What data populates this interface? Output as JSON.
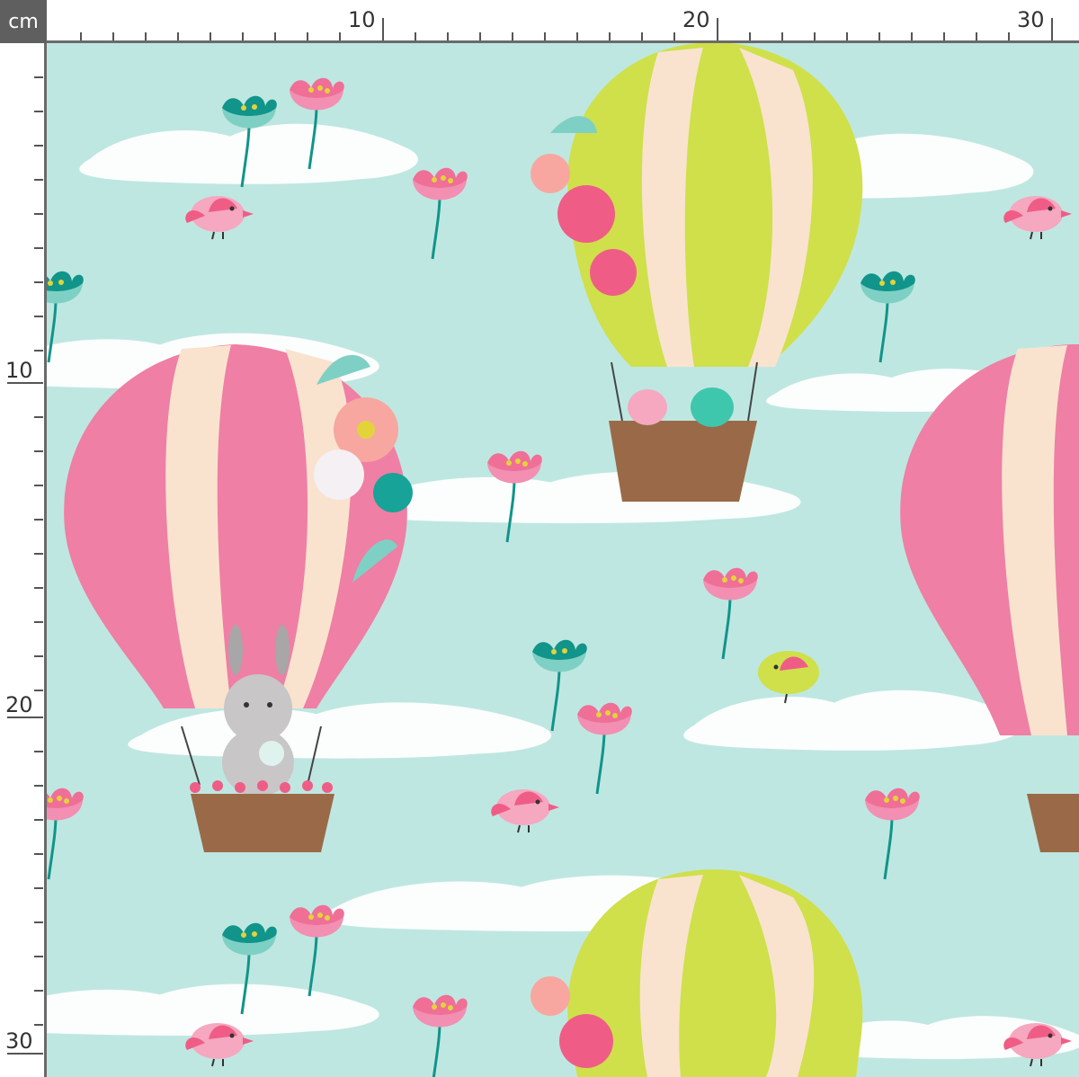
{
  "ruler": {
    "unit": "cm",
    "top_labels": [
      "10",
      "20",
      "30"
    ],
    "left_labels": [
      "10",
      "20",
      "30"
    ]
  },
  "colors": {
    "sky": "#bfe7e1",
    "cloud": "#ffffff",
    "pink": "#ef7fa4",
    "cream": "#f9e3cf",
    "lime": "#cfe04a",
    "teal": "#11948a",
    "basket": "#9a6a48",
    "ruler_dark": "#5f5f5f"
  },
  "fabric": {
    "motifs": [
      "pink-balloon-with-bunny",
      "lime-balloon-with-birds",
      "flower-icon",
      "bird-icon",
      "cloud"
    ]
  }
}
